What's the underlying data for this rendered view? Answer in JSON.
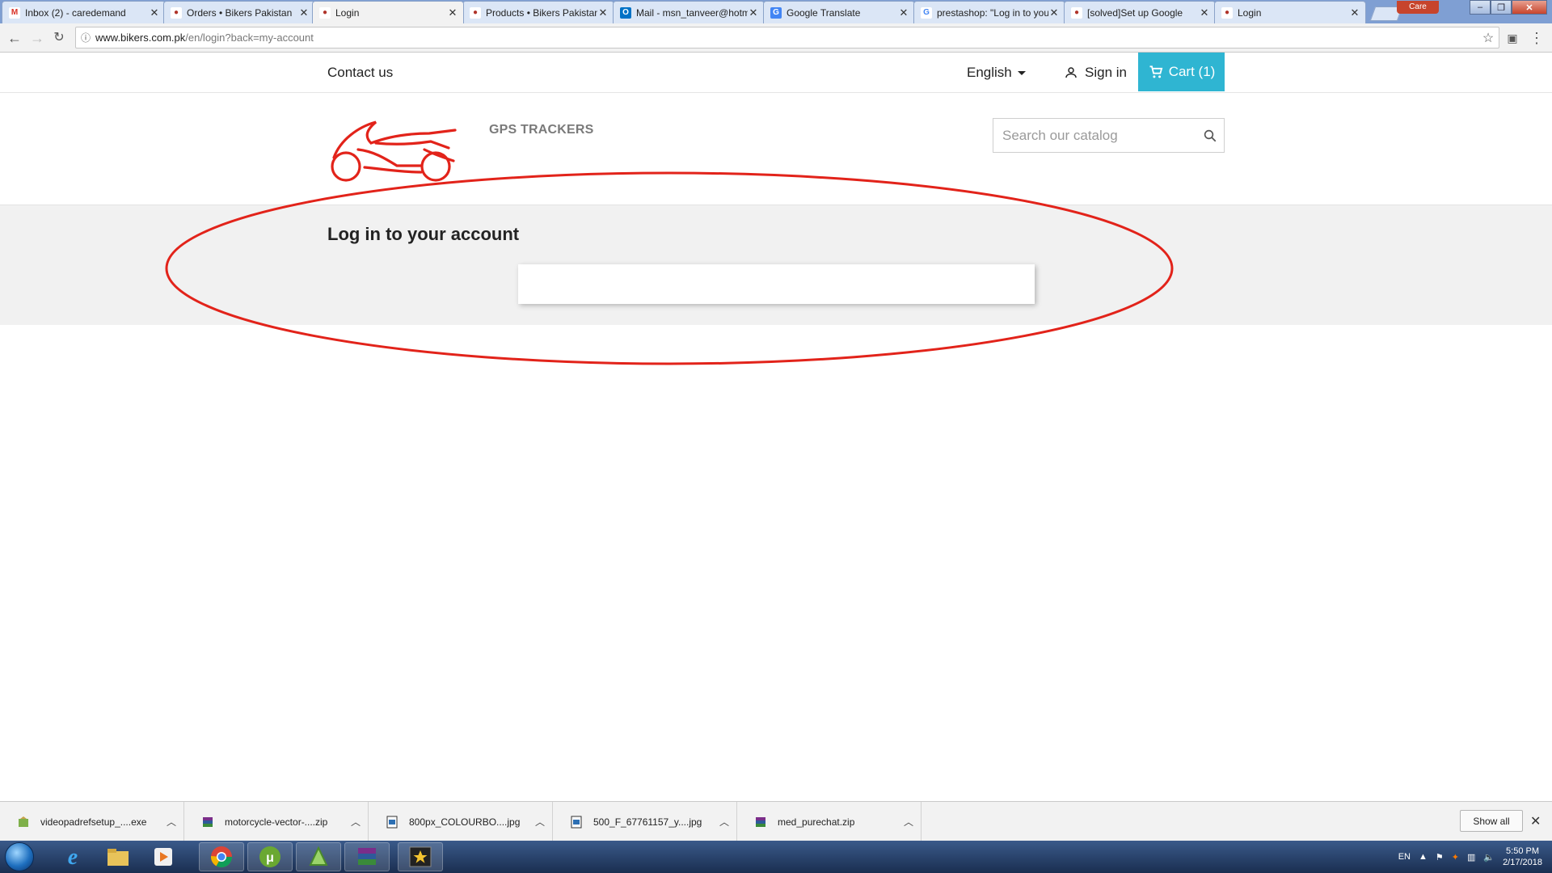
{
  "browser": {
    "tabs": [
      {
        "title": "Inbox (2) - caredemand",
        "icon": "gmail-icon",
        "color": "#d93025",
        "active": false
      },
      {
        "title": "Orders • Bikers Pakistan",
        "icon": "prestashop-icon",
        "color": "#b0342a",
        "active": false
      },
      {
        "title": "Login",
        "icon": "prestashop-icon",
        "color": "#b0342a",
        "active": true
      },
      {
        "title": "Products • Bikers Pakistan",
        "icon": "prestashop-icon",
        "color": "#b0342a",
        "active": false
      },
      {
        "title": "Mail - msn_tanveer@hotmail",
        "icon": "outlook-icon",
        "color": "#0072c6",
        "active": false
      },
      {
        "title": "Google Translate",
        "icon": "translate-icon",
        "color": "#4285f4",
        "active": false
      },
      {
        "title": "prestashop: \"Log in to your",
        "icon": "google-icon",
        "color": "#4285f4",
        "active": false
      },
      {
        "title": "[solved]Set up Google",
        "icon": "prestashop-icon",
        "color": "#b0342a",
        "active": false
      },
      {
        "title": "Login",
        "icon": "prestashop-icon",
        "color": "#b0342a",
        "active": false
      }
    ],
    "user_badge": "Care",
    "url_host": "www.bikers.com.pk",
    "url_path": "/en/login?back=my-account"
  },
  "site": {
    "nav": {
      "contact": "Contact us",
      "language": "English",
      "signin": "Sign in",
      "cart": "Cart (1)"
    },
    "menu": {
      "gps": "GPS TRACKERS"
    },
    "search": {
      "placeholder": "Search our catalog"
    },
    "page_title": "Log in to your account",
    "brand_color": "#e2231a",
    "accent_color": "#2fb5d2"
  },
  "downloads": {
    "items": [
      {
        "name": "videopadrefsetup_....exe",
        "icon": "installer-icon"
      },
      {
        "name": "motorcycle-vector-....zip",
        "icon": "archive-icon"
      },
      {
        "name": "800px_COLOURBO....jpg",
        "icon": "image-file-icon"
      },
      {
        "name": "500_F_67761157_y....jpg",
        "icon": "image-file-icon"
      },
      {
        "name": "med_purechat.zip",
        "icon": "archive-icon"
      }
    ],
    "show_all": "Show all"
  },
  "taskbar": {
    "lang": "EN",
    "time": "5:50 PM",
    "date": "2/17/2018"
  }
}
